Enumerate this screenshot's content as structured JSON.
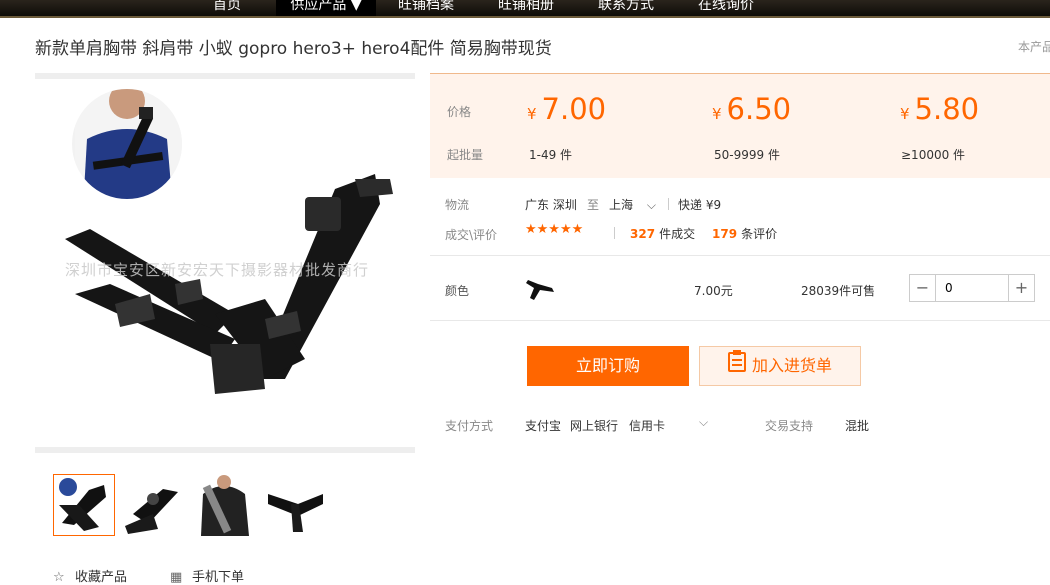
{
  "nav": {
    "items": [
      "首页",
      "供应产品 ▼",
      "旺铺档案",
      "旺铺相册",
      "联系方式",
      "在线询价"
    ]
  },
  "title": "新款单肩胸带 斜肩带 小蚁 gopro hero3+ hero4配件 简易胸带现货",
  "corner_text": "本产品",
  "gallery": {
    "watermark": "深圳市宝安区新安宏天下摄影器材批发商行"
  },
  "price": {
    "price_label": "价格",
    "qty_label": "起批量",
    "currency": "¥",
    "tiers": [
      {
        "price": "7.00",
        "qty": "1-49 件"
      },
      {
        "price": "6.50",
        "qty": "50-9999 件"
      },
      {
        "price": "5.80",
        "qty": "≥10000 件"
      }
    ]
  },
  "logistics": {
    "label": "物流",
    "from": "广东 深圳",
    "to_word": "至",
    "to": "上海",
    "method": "快递 ¥9"
  },
  "reviews": {
    "label": "成交\\评价",
    "stars": "★★★★★",
    "deals_count": "327",
    "deals_text": "件成交",
    "reviews_count": "179",
    "reviews_text": "条评价"
  },
  "sku": {
    "label": "颜色",
    "price": "7.00元",
    "stock": "28039件可售",
    "quantity": "0",
    "minus": "−",
    "plus": "+"
  },
  "actions": {
    "buy": "立即订购",
    "cart": "加入进货单"
  },
  "payment": {
    "label": "支付方式",
    "methods": [
      "支付宝",
      "网上银行",
      "信用卡"
    ],
    "support_label": "交易支持",
    "support_value": "混批"
  },
  "footer": {
    "favorite": "收藏产品",
    "mobile": "手机下单"
  },
  "colors": {
    "accent": "#ff6600",
    "price_bg": "#fff3eb"
  }
}
